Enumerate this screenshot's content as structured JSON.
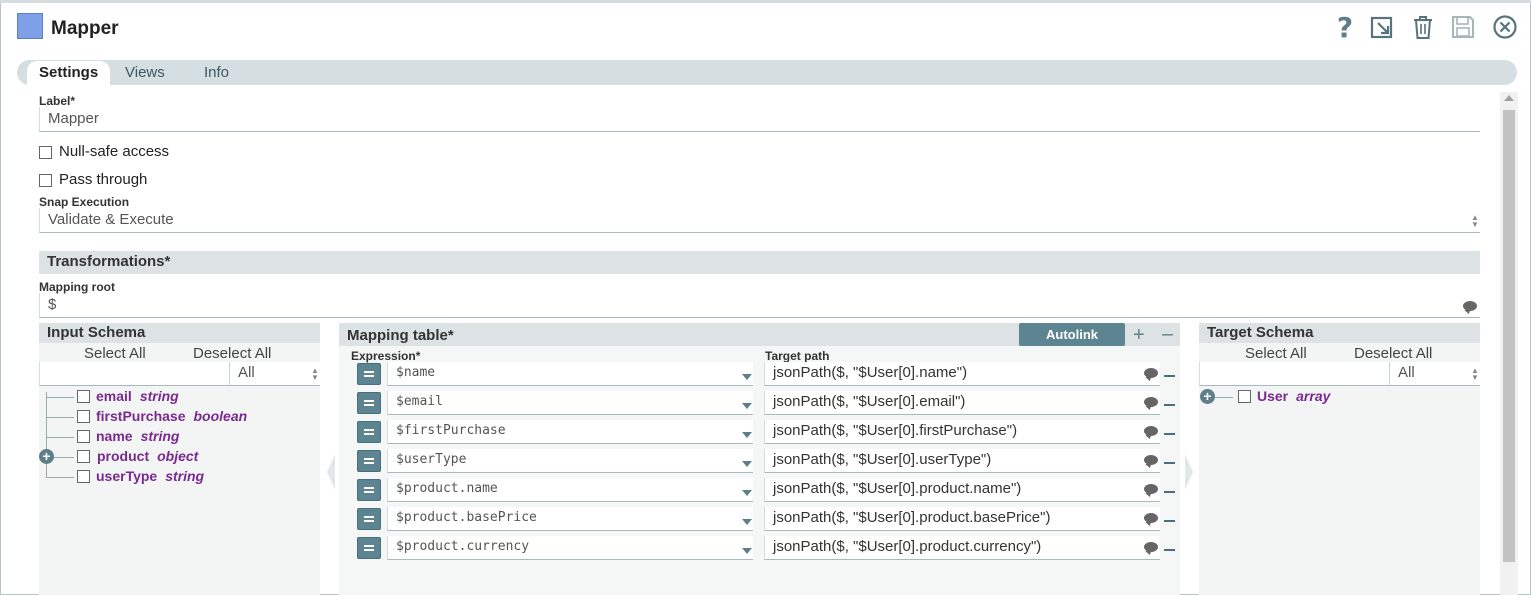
{
  "app": {
    "title": "Mapper"
  },
  "header_icons": [
    "help-icon",
    "export-icon",
    "trash-icon",
    "save-icon",
    "close-icon"
  ],
  "tabs": [
    {
      "label": "Settings",
      "active": true
    },
    {
      "label": "Views",
      "active": false
    },
    {
      "label": "Info",
      "active": false
    }
  ],
  "settings": {
    "label_caption": "Label*",
    "label_value": "Mapper",
    "null_safe_label": "Null-safe access",
    "pass_through_label": "Pass through",
    "snap_execution_caption": "Snap Execution",
    "snap_execution_value": "Validate & Execute"
  },
  "transformations": {
    "heading": "Transformations*",
    "mapping_root_caption": "Mapping root",
    "mapping_root_value": "$"
  },
  "input_schema": {
    "heading": "Input Schema",
    "select_all": "Select All",
    "deselect_all": "Deselect All",
    "filter_value": "All",
    "fields": [
      {
        "name": "email",
        "type": "string"
      },
      {
        "name": "firstPurchase",
        "type": "boolean"
      },
      {
        "name": "name",
        "type": "string"
      },
      {
        "name": "product",
        "type": "object"
      },
      {
        "name": "userType",
        "type": "string"
      }
    ]
  },
  "mapping_table": {
    "heading": "Mapping table*",
    "autolink_label": "Autolink",
    "add_label": "+",
    "remove_label": "–",
    "expression_caption": "Expression*",
    "target_caption": "Target path",
    "rows": [
      {
        "expression": "$name",
        "target": "jsonPath($, \"$User[0].name\")"
      },
      {
        "expression": "$email",
        "target": "jsonPath($, \"$User[0].email\")"
      },
      {
        "expression": "$firstPurchase",
        "target": "jsonPath($, \"$User[0].firstPurchase\")"
      },
      {
        "expression": "$userType",
        "target": "jsonPath($, \"$User[0].userType\")"
      },
      {
        "expression": "$product.name",
        "target": "jsonPath($, \"$User[0].product.name\")"
      },
      {
        "expression": "$product.basePrice",
        "target": "jsonPath($, \"$User[0].product.basePrice\")"
      },
      {
        "expression": "$product.currency",
        "target": "jsonPath($, \"$User[0].product.currency\")"
      }
    ]
  },
  "target_schema": {
    "heading": "Target Schema",
    "select_all": "Select All",
    "deselect_all": "Deselect All",
    "filter_value": "All",
    "fields": [
      {
        "name": "User",
        "type": "array"
      }
    ]
  },
  "colors": {
    "accent": "#5d8491",
    "schema_text": "#7a2a8f",
    "tab_bar": "#d5dee1",
    "app_icon": "#7f9fe6"
  }
}
